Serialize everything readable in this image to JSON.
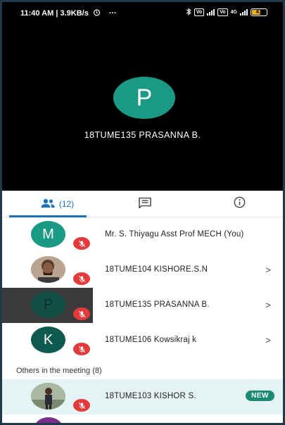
{
  "status_bar": {
    "time_speed": "11:40 AM | 3.9KB/s",
    "alarm_icon": "alarm-icon",
    "more": "···",
    "bluetooth_icon": "bluetooth-icon",
    "vol_label_1": "Vo",
    "vol_label_2": "Vo",
    "net_label": "4G",
    "battery_level": "41"
  },
  "speaker": {
    "initial": "P",
    "name": "18TUME135 PRASANNA B.",
    "avatar_color": "#1a9985"
  },
  "tabs": {
    "people_count": "(12)",
    "people_icon": "people-icon",
    "chat_icon": "chat-icon",
    "info_icon": "info-icon",
    "accent": "#1a73b8"
  },
  "participants": [
    {
      "initial": "M",
      "name": "Mr. S. Thiyagu Asst Prof MECH (You)",
      "color": "#1a9985",
      "chevron": ""
    },
    {
      "initial": "",
      "name": "18TUME104 KISHORE.S.N",
      "color": "#6b4a3a",
      "chevron": ">"
    },
    {
      "initial": "P",
      "name": "18TUME135 PRASANNA B.",
      "color": "#124f47",
      "chevron": ">"
    },
    {
      "initial": "K",
      "name": "18TUME106 Kowsikraj k",
      "color": "#0f5a4e",
      "chevron": ">"
    }
  ],
  "others": {
    "label": "Others in the meeting (8)",
    "items": [
      {
        "name": "18TUME103 KISHOR S.",
        "badge": "NEW"
      }
    ]
  },
  "colors": {
    "mic_off": "#e33b3b",
    "highlight_row": "#e6f3f4",
    "new_badge": "#1a8a72"
  }
}
